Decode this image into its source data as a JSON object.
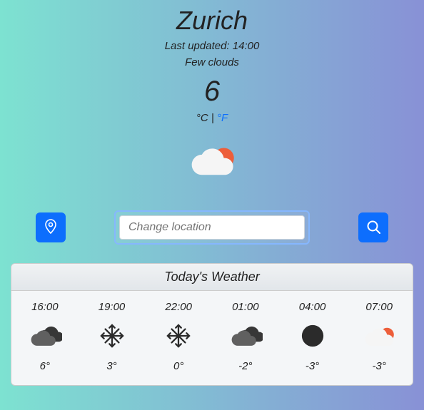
{
  "city": "Zurich",
  "last_updated": "Last updated: 14:00",
  "description": "Few clouds",
  "temperature": "6",
  "units": {
    "c": "°C",
    "sep": " | ",
    "f": "°F"
  },
  "search": {
    "placeholder": "Change location",
    "value": ""
  },
  "forecast_title": "Today's Weather",
  "forecast": [
    {
      "time": "16:00",
      "temp": "6°",
      "icon": "cloudy-dark"
    },
    {
      "time": "19:00",
      "temp": "3°",
      "icon": "snow"
    },
    {
      "time": "22:00",
      "temp": "0°",
      "icon": "snow"
    },
    {
      "time": "01:00",
      "temp": "-2°",
      "icon": "cloudy-dark"
    },
    {
      "time": "04:00",
      "temp": "-3°",
      "icon": "moon"
    },
    {
      "time": "07:00",
      "temp": "-3°",
      "icon": "sun-cloud"
    }
  ]
}
